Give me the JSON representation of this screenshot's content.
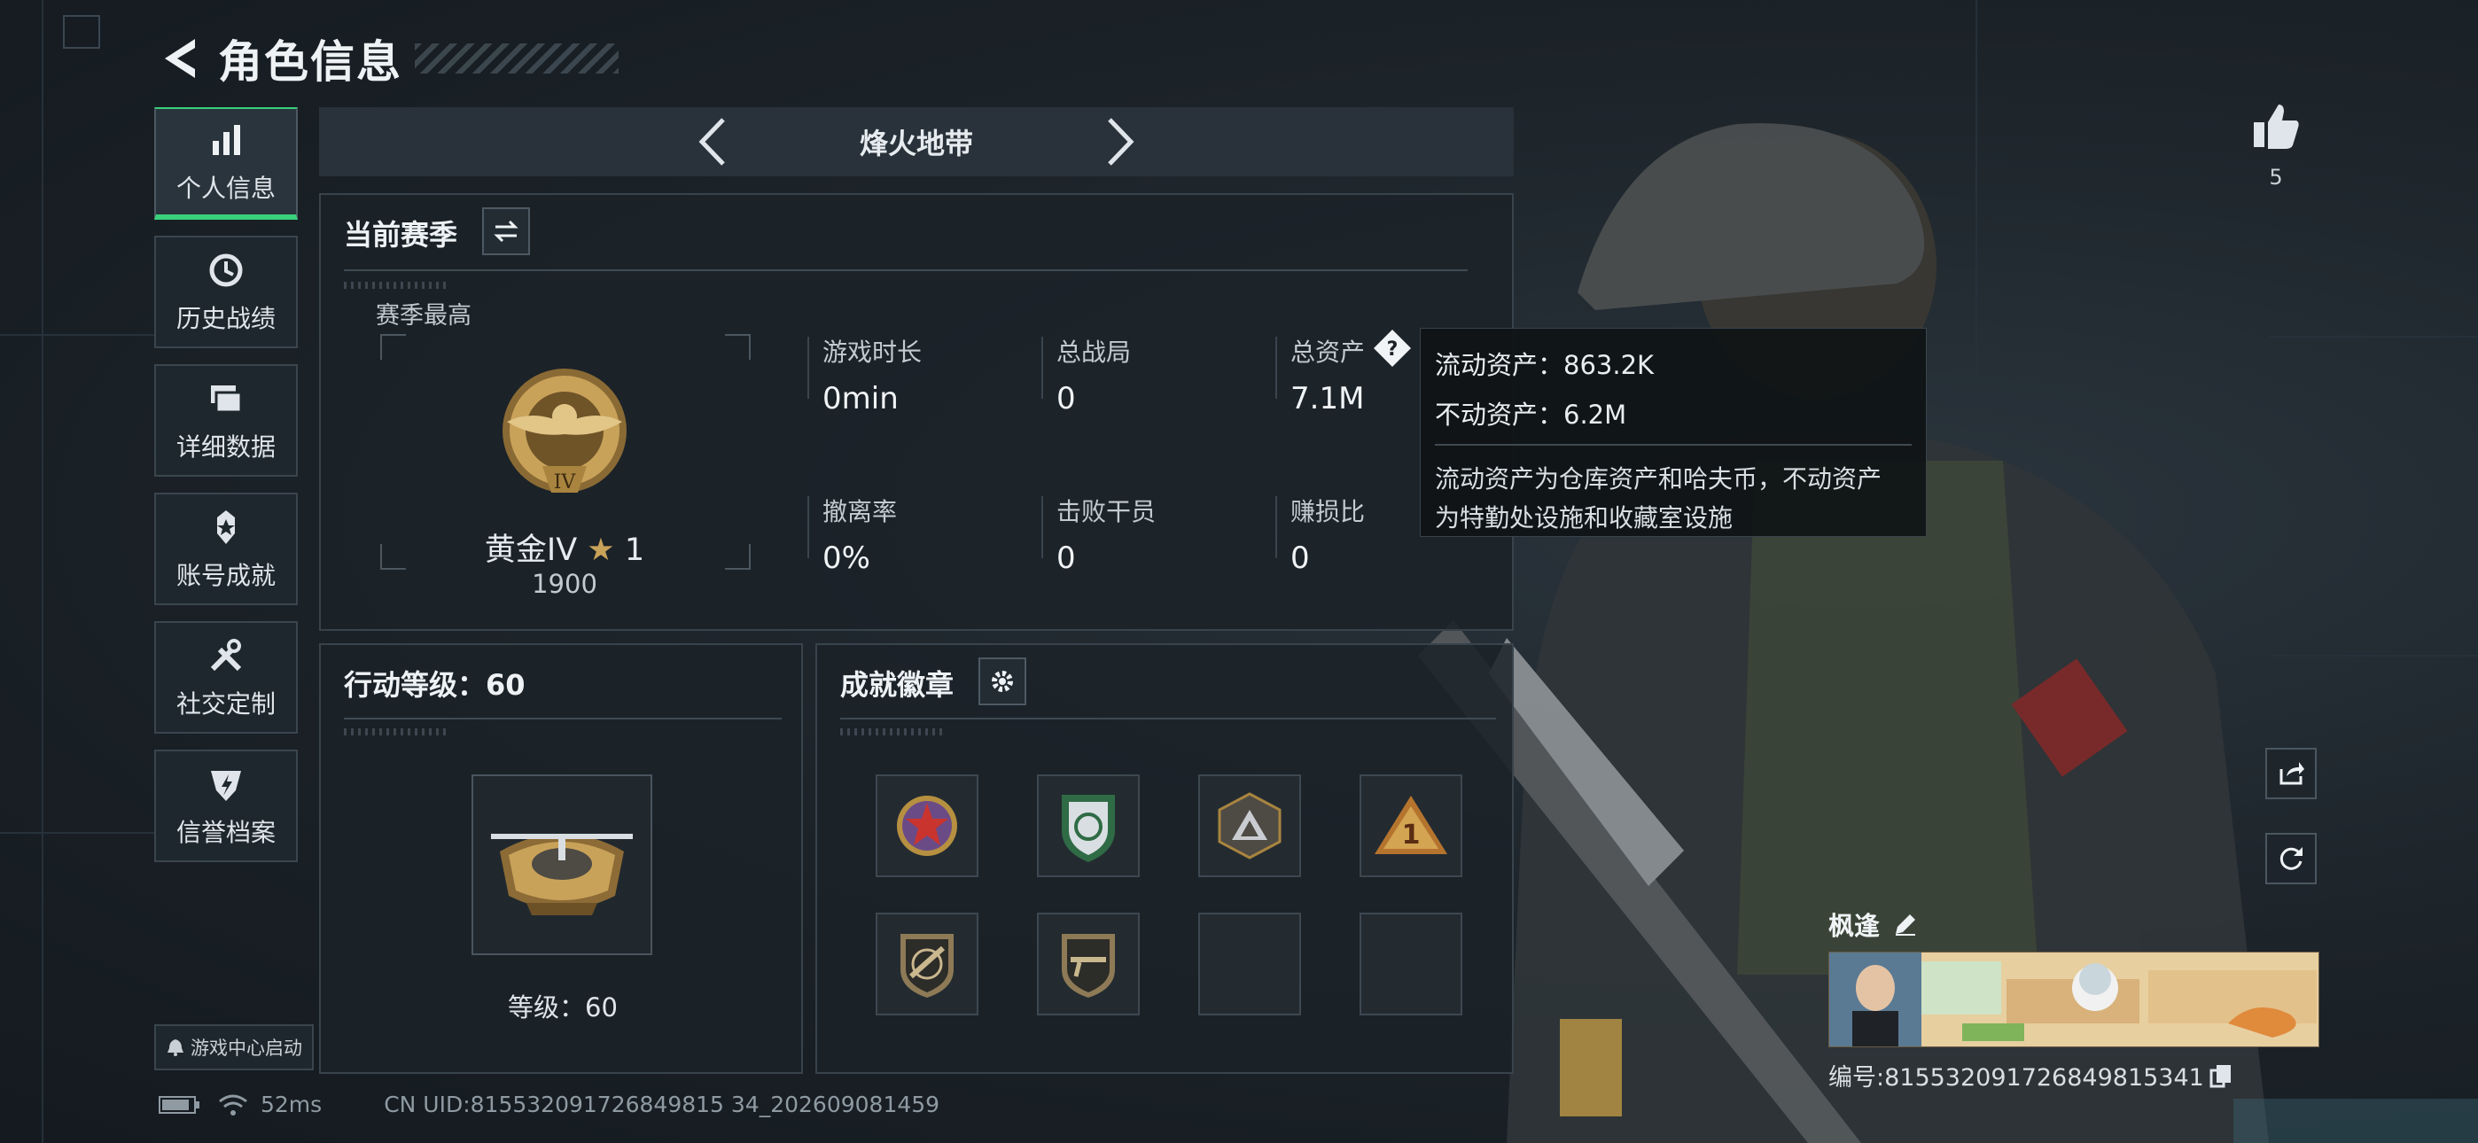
{
  "header": {
    "title": "角色信息"
  },
  "nav": {
    "items": [
      {
        "label": "个人信息",
        "icon": "bar-chart-icon",
        "active": true
      },
      {
        "label": "历史战绩",
        "icon": "history-icon",
        "active": false
      },
      {
        "label": "详细数据",
        "icon": "folders-icon",
        "active": false
      },
      {
        "label": "账号成就",
        "icon": "achievement-icon",
        "active": false
      },
      {
        "label": "社交定制",
        "icon": "tools-icon",
        "active": false
      },
      {
        "label": "信誉档案",
        "icon": "credit-shield-icon",
        "active": false
      }
    ],
    "launch_label": "游戏中心启动"
  },
  "mode": {
    "name": "烽火地带"
  },
  "season": {
    "title": "当前赛季",
    "best_label": "赛季最高",
    "rank_name": "黄金IV",
    "rank_stars": "1",
    "rank_score": "1900",
    "stats": [
      {
        "label": "游戏时长",
        "value": "0min"
      },
      {
        "label": "总战局",
        "value": "0"
      },
      {
        "label": "总资产",
        "value": "7.1M"
      },
      {
        "label": "撤离率",
        "value": "0%"
      },
      {
        "label": "击败干员",
        "value": "0"
      },
      {
        "label": "赚损比",
        "value": "0"
      }
    ]
  },
  "tooltip": {
    "liquid": "流动资产：863.2K",
    "fixed": "不动资产：6.2M",
    "desc_line1": "流动资产为仓库资产和哈夫币，不动资产",
    "desc_line2": "为特勤处设施和收藏室设施"
  },
  "level": {
    "title": "行动等级：60",
    "level_text": "等级：60"
  },
  "badges": {
    "title": "成就徽章",
    "items": [
      "red-star-badge",
      "green-shield-badge",
      "gray-triangle-badge",
      "gold-1-badge",
      "rifle-badge",
      "rifle-badge-2",
      "empty",
      "empty"
    ]
  },
  "likes": {
    "count": "5"
  },
  "player": {
    "name": "枫逢",
    "id_text": "编号:815532091726849815341"
  },
  "status": {
    "ping": "52ms",
    "uid": "CN UID:815532091726849815 34_202609081459"
  },
  "colors": {
    "accent_green": "#39d17c",
    "gold": "#c9a25a"
  }
}
